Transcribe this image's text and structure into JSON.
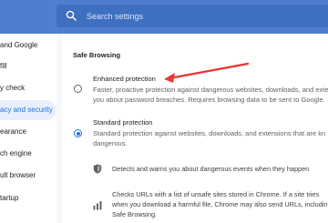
{
  "search": {
    "placeholder": "Search settings"
  },
  "sidebar": {
    "items": [
      {
        "label": "and Google"
      },
      {
        "label": "fill"
      },
      {
        "label": "y check"
      },
      {
        "label": "acy and security"
      },
      {
        "label": "earance"
      },
      {
        "label": "ch engine"
      },
      {
        "label": "ult browser"
      },
      {
        "label": "tartup"
      }
    ]
  },
  "main": {
    "section_title": "Safe Browsing",
    "options": [
      {
        "title": "Enhanced protection",
        "desc_lines": [
          "Faster, proactive protection against dangerous websites, downloads, and exte",
          "you about password breaches. Requires browsing data to be sent to Google."
        ],
        "selected": false
      },
      {
        "title": "Standard protection",
        "desc_lines": [
          "Standard protection against websites, downloads, and extensions that are kn",
          "dangerous."
        ],
        "selected": true
      }
    ],
    "sub_items": [
      {
        "icon": "shield-icon",
        "lines": [
          "Detects and warns you about dangerous events when they happen"
        ]
      },
      {
        "icon": "signal-bars-icon",
        "lines": [
          "Checks URLs with a list of unsafe sites stored in Chrome. If a site tries",
          "when you download a harmful file, Chrome may also send URLs, includin",
          "Safe Browsing."
        ]
      }
    ]
  },
  "colors": {
    "accent": "#1a73e8",
    "topbar": "#4f7ecf",
    "annotation_arrow": "#e53935"
  }
}
